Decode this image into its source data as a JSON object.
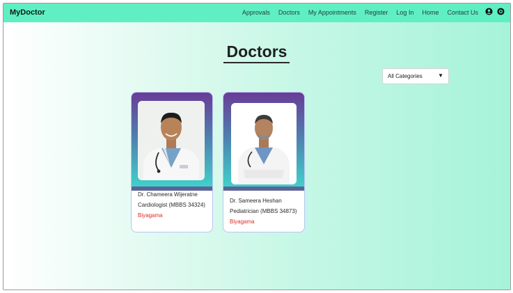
{
  "navbar": {
    "brand": "MyDoctor",
    "links": [
      "Approvals",
      "Doctors",
      "My Appointments",
      "Register",
      "Log In",
      "Home",
      "Contact Us"
    ],
    "icons": [
      "user-icon",
      "account-circle-icon"
    ]
  },
  "page": {
    "title": "Doctors"
  },
  "filter": {
    "selected": "All Categories",
    "arrow": "▼"
  },
  "doctors": [
    {
      "name": "Dr. Chameera Wijeratne",
      "specialty": "Cardiologist (MBBS 34324)",
      "location": "Biyagama"
    },
    {
      "name": "Dr. Sameera Heshan",
      "specialty": "Pediatrician (MBBS 34873)",
      "location": "Biyagama"
    }
  ],
  "colors": {
    "navbar": "#5fefc2",
    "location": "#e02a2a",
    "card_gradient_top": "#6a3b97",
    "card_gradient_bottom": "#3fd7cd"
  }
}
